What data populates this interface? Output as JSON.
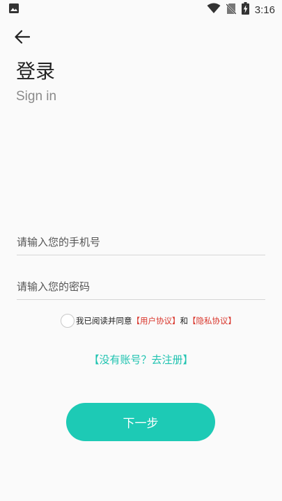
{
  "status_bar": {
    "time": "3:16",
    "icons": [
      "image-icon",
      "wifi-icon",
      "no-sim-icon",
      "battery-charging-icon"
    ]
  },
  "header": {
    "back_icon": "arrow-left-icon",
    "title": "登录",
    "subtitle": "Sign in"
  },
  "form": {
    "phone_placeholder": "请输入您的手机号",
    "phone_value": "",
    "password_placeholder": "请输入您的密码",
    "password_value": ""
  },
  "agreement": {
    "checked": false,
    "prefix": "我已阅读并同意",
    "user_agreement": "【用户协议】",
    "conjunction": "和",
    "privacy_policy": "【隐私协议】"
  },
  "register_link": "【没有账号？去注册】",
  "next_button": "下一步",
  "colors": {
    "accent": "#1dcab5",
    "link_teal": "#1fc3b0",
    "link_red": "#d9352b",
    "background": "#fafafa"
  }
}
